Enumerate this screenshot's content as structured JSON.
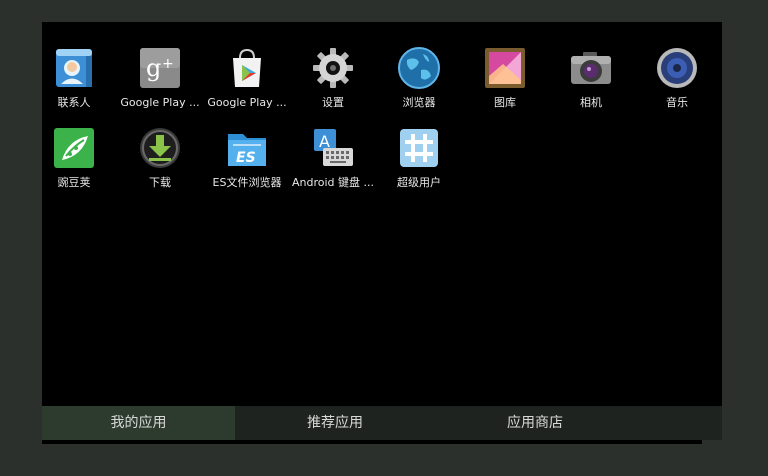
{
  "apps": [
    {
      "label": "联系人",
      "icon": "contacts-icon"
    },
    {
      "label": "Google Play ...",
      "icon": "google-plus-icon"
    },
    {
      "label": "Google Play ...",
      "icon": "play-store-icon"
    },
    {
      "label": "设置",
      "icon": "gear-icon"
    },
    {
      "label": "浏览器",
      "icon": "globe-icon"
    },
    {
      "label": "图库",
      "icon": "gallery-icon"
    },
    {
      "label": "相机",
      "icon": "camera-icon"
    },
    {
      "label": "音乐",
      "icon": "speaker-icon"
    },
    {
      "label": "豌豆荚",
      "icon": "wandoujia-icon"
    },
    {
      "label": "下载",
      "icon": "download-icon"
    },
    {
      "label": "ES文件浏览器",
      "icon": "es-file-explorer-icon"
    },
    {
      "label": "Android 键盘 ...",
      "icon": "keyboard-icon"
    },
    {
      "label": "超级用户",
      "icon": "superuser-icon"
    }
  ],
  "tabs": [
    {
      "label": "我的应用",
      "active": true
    },
    {
      "label": "推荐应用",
      "active": false
    },
    {
      "label": "应用商店",
      "active": false
    }
  ],
  "colors": {
    "frame": "#2c302d",
    "screen": "#000000",
    "tab_active": "#2d3b2f",
    "tab_bar": "#1f2320"
  }
}
